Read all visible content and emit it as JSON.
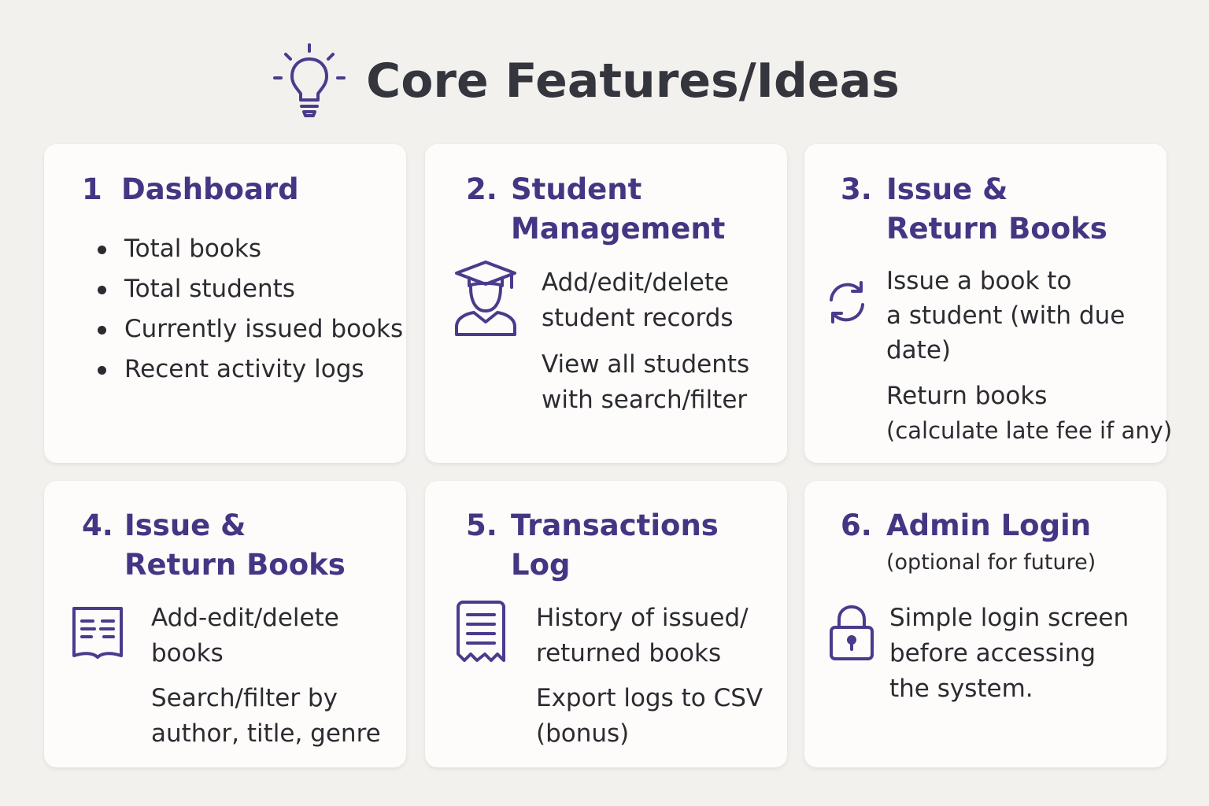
{
  "header": {
    "title": "Core Features/Ideas",
    "icon": "lightbulb-icon"
  },
  "colors": {
    "background": "#f3f1ee",
    "card": "#fdfcfb",
    "accent": "#463583",
    "title": "#34353d"
  },
  "cards": [
    {
      "number": "1",
      "title_lines": [
        "Dashboard"
      ],
      "bullets": [
        "Total books",
        "Total students",
        "Currently issued books",
        "Recent activity logs"
      ]
    },
    {
      "number": "2.",
      "title_lines": [
        "Student",
        "Management"
      ],
      "icon": "graduate-student-icon",
      "items": [
        [
          "Add/edit/delete",
          "student records"
        ],
        [
          "View all students",
          "with search/filter"
        ]
      ]
    },
    {
      "number": "3.",
      "title_lines": [
        "Issue &",
        "Return Books"
      ],
      "icon": "refresh-cycle-icon",
      "items": [
        [
          "Issue a book to",
          "a student (with due",
          "date)"
        ],
        [
          "Return books",
          "(calculate late fee if any)"
        ]
      ]
    },
    {
      "number": "4.",
      "title_lines": [
        "Issue &",
        "Return Books"
      ],
      "icon": "book-icon",
      "items": [
        [
          "Add-edit/delete",
          "books"
        ],
        [
          "Search/filter by",
          "author, title, genre"
        ]
      ]
    },
    {
      "number": "5.",
      "title_lines": [
        "Transactions",
        "Log"
      ],
      "icon": "receipt-log-icon",
      "items": [
        [
          "History of issued/",
          "returned books"
        ],
        [
          "Export logs to CSV",
          "(bonus)"
        ]
      ]
    },
    {
      "number": "6.",
      "title_lines": [
        "Admin Login"
      ],
      "subtitle": "(optional for future)",
      "icon": "padlock-icon",
      "items": [
        [
          "Simple login screen",
          "before accessing",
          "the system."
        ]
      ]
    }
  ]
}
